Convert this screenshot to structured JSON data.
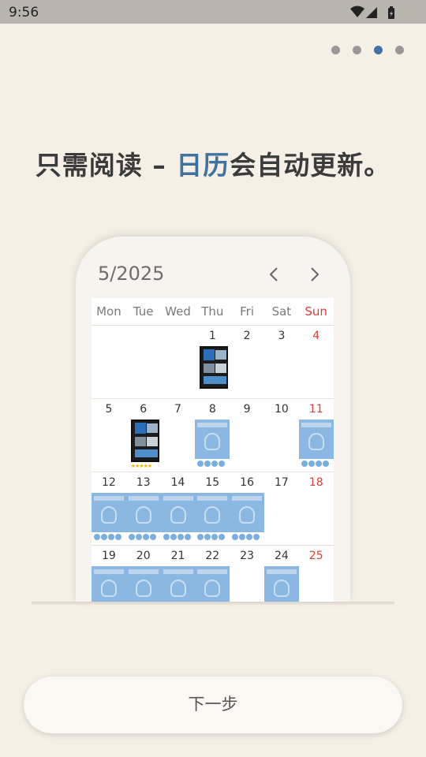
{
  "status_bar": {
    "time": "9:56"
  },
  "headline": {
    "part1": "只需阅读 – ",
    "highlight": "日历",
    "part2": "会自动更新。"
  },
  "calendar": {
    "month_label": "5/2025",
    "weekdays": [
      "Mon",
      "Tue",
      "Wed",
      "Thu",
      "Fri",
      "Sat",
      "Sun"
    ],
    "weeks": [
      [
        "",
        "",
        "",
        "1",
        "2",
        "3",
        "4"
      ],
      [
        "5",
        "6",
        "7",
        "8",
        "9",
        "10",
        "11"
      ],
      [
        "12",
        "13",
        "14",
        "15",
        "16",
        "17",
        "18"
      ],
      [
        "19",
        "20",
        "21",
        "22",
        "23",
        "24",
        "25"
      ]
    ]
  },
  "next_button": {
    "label": "下一步"
  },
  "colors": {
    "accent": "#3e73a1",
    "sunday": "#d9413b",
    "background": "#f5efe6"
  }
}
